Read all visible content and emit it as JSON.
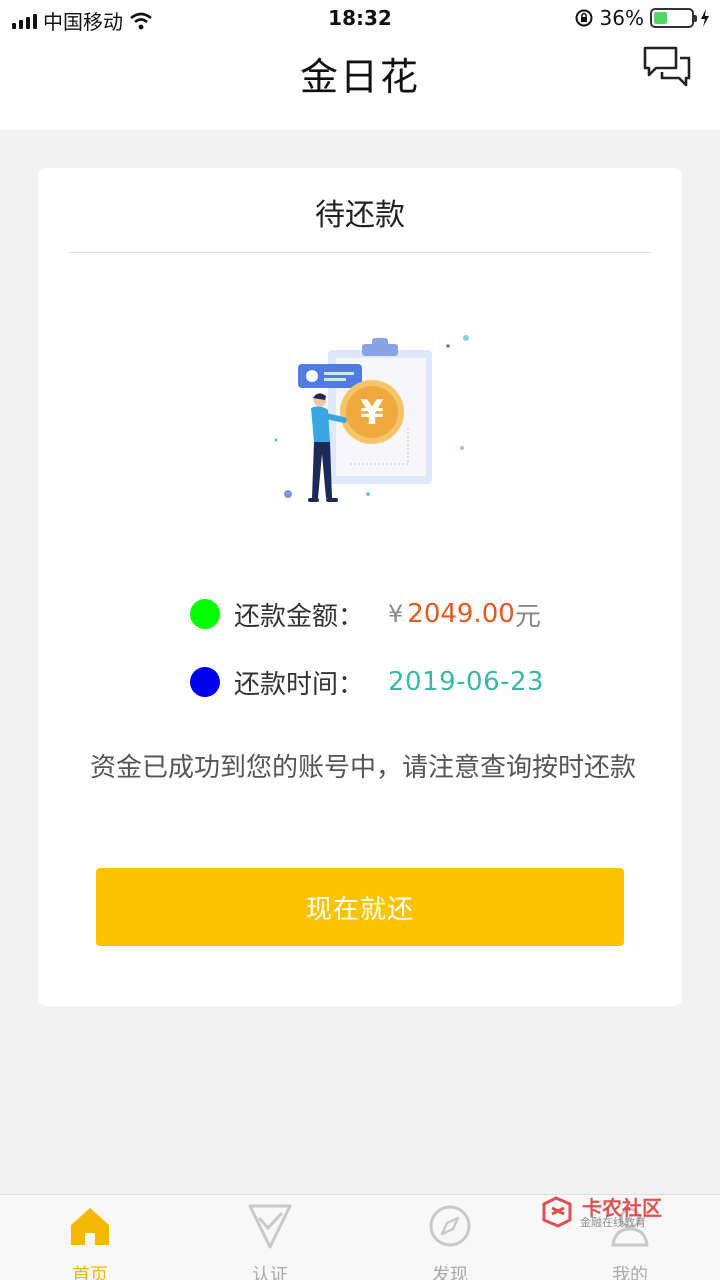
{
  "status_bar": {
    "carrier": "中国移动",
    "time": "18:32",
    "battery_percent": "36%",
    "battery_level": 0.36,
    "battery_color": "#4cd964"
  },
  "nav": {
    "title": "金日花",
    "chat_icon": "chat-bubbles-icon"
  },
  "card": {
    "title": "待还款",
    "illustration_icon": "clipboard-coin-person-illustration",
    "yen_symbol": "¥",
    "rows": [
      {
        "label": "还款金额：",
        "value": "2049.00",
        "unit": "元",
        "dot_color": "#00ff00",
        "value_color": "#e35a1f"
      },
      {
        "label": "还款时间：",
        "value": "2019-06-23",
        "dot_color": "#0000ee",
        "value_color": "#3bb7a6"
      }
    ],
    "notice": "资金已成功到您的账号中，请注意查询按时还款",
    "button_label": "现在就还",
    "button_color": "#fdc300"
  },
  "tabs": [
    {
      "label": "首页",
      "icon": "home-icon",
      "active": true
    },
    {
      "label": "认证",
      "icon": "checkmark-shield-icon",
      "active": false
    },
    {
      "label": "发现",
      "icon": "compass-icon",
      "active": false
    },
    {
      "label": "我的",
      "icon": "person-icon",
      "active": false
    }
  ],
  "watermark": {
    "text": "卡农社区",
    "subtext": "金融在线教育"
  }
}
